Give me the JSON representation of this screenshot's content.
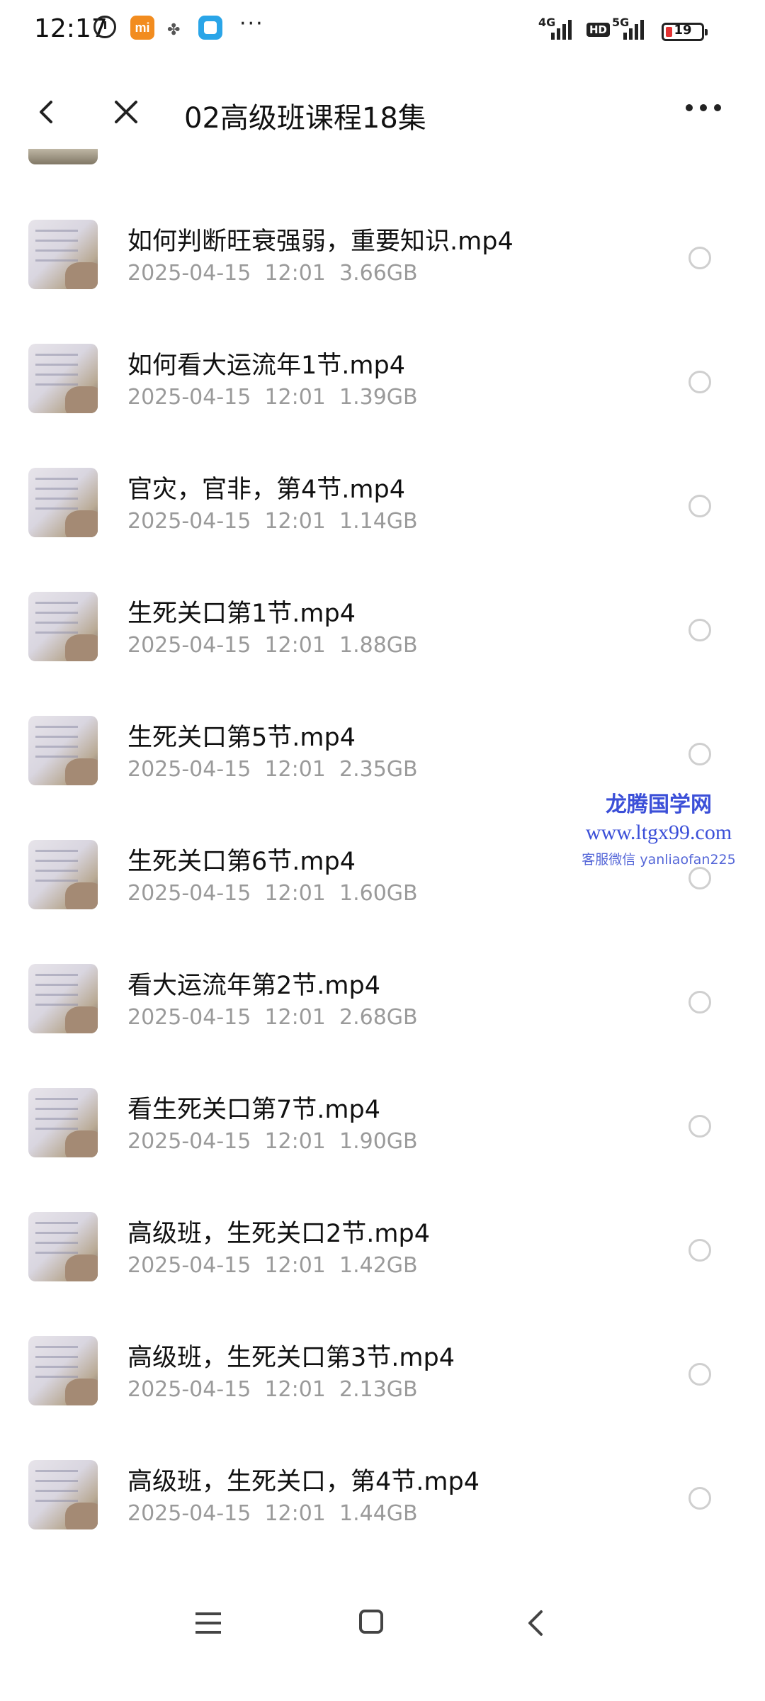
{
  "status_bar": {
    "time": "12:17",
    "mi_label": "mi",
    "net1": "4G",
    "hd": "HD",
    "net2": "5G",
    "battery": "19",
    "battery_level": 0.19,
    "battery_color": "#e33333"
  },
  "header": {
    "title": "02高级班课程18集"
  },
  "files": [
    {
      "name": "如何判断旺衰强弱，重要知识.mp4",
      "date": "2025-04-15",
      "time": "12:01",
      "size": "3.66GB"
    },
    {
      "name": "如何看大运流年1节.mp4",
      "date": "2025-04-15",
      "time": "12:01",
      "size": "1.39GB"
    },
    {
      "name": "官灾，官非，第4节.mp4",
      "date": "2025-04-15",
      "time": "12:01",
      "size": "1.14GB"
    },
    {
      "name": "生死关口第1节.mp4",
      "date": "2025-04-15",
      "time": "12:01",
      "size": "1.88GB"
    },
    {
      "name": "生死关口第5节.mp4",
      "date": "2025-04-15",
      "time": "12:01",
      "size": "2.35GB"
    },
    {
      "name": "生死关口第6节.mp4",
      "date": "2025-04-15",
      "time": "12:01",
      "size": "1.60GB"
    },
    {
      "name": "看大运流年第2节.mp4",
      "date": "2025-04-15",
      "time": "12:01",
      "size": "2.68GB"
    },
    {
      "name": "看生死关口第7节.mp4",
      "date": "2025-04-15",
      "time": "12:01",
      "size": "1.90GB"
    },
    {
      "name": "高级班，生死关口2节.mp4",
      "date": "2025-04-15",
      "time": "12:01",
      "size": "1.42GB"
    },
    {
      "name": "高级班，生死关口第3节.mp4",
      "date": "2025-04-15",
      "time": "12:01",
      "size": "2.13GB"
    },
    {
      "name": "高级班，生死关口，第4节.mp4",
      "date": "2025-04-15",
      "time": "12:01",
      "size": "1.44GB"
    }
  ],
  "watermark": {
    "title": "龙腾国学网",
    "url": "www.ltgx99.com",
    "contact": "客服微信 yanliaofan225"
  }
}
